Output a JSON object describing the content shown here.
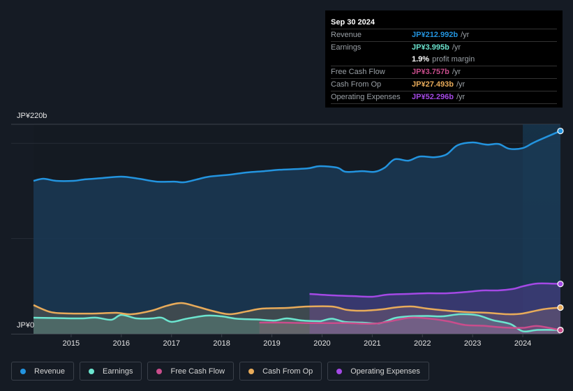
{
  "tooltip": {
    "date": "Sep 30 2024",
    "rows": [
      {
        "label": "Revenue",
        "value": "JP¥212.992b",
        "unit": "/yr",
        "color": "#2394df"
      },
      {
        "label": "Earnings",
        "value": "JP¥3.995b",
        "unit": "/yr",
        "color": "#6ce5cf"
      },
      {
        "label": "",
        "value": "1.9%",
        "unit": "profit margin",
        "color": "#ffffff"
      },
      {
        "label": "Free Cash Flow",
        "value": "JP¥3.757b",
        "unit": "/yr",
        "color": "#c94d8c"
      },
      {
        "label": "Cash From Op",
        "value": "JP¥27.493b",
        "unit": "/yr",
        "color": "#e8ab5a"
      },
      {
        "label": "Operating Expenses",
        "value": "JP¥52.296b",
        "unit": "/yr",
        "color": "#a449e5"
      }
    ]
  },
  "legend": [
    {
      "label": "Revenue",
      "color": "#2394df"
    },
    {
      "label": "Earnings",
      "color": "#6ce5cf"
    },
    {
      "label": "Free Cash Flow",
      "color": "#c94d8c"
    },
    {
      "label": "Cash From Op",
      "color": "#e8ab5a"
    },
    {
      "label": "Operating Expenses",
      "color": "#a449e5"
    }
  ],
  "chart_data": {
    "type": "area",
    "title": "",
    "xlabel": "",
    "ylabel": "",
    "y_top_label": "JP¥220b",
    "y_bottom_label": "JP¥0",
    "ylim": [
      0,
      220
    ],
    "xlim": [
      2014.25,
      2024.75
    ],
    "x_ticks": [
      2015,
      2016,
      2017,
      2018,
      2019,
      2020,
      2021,
      2022,
      2023,
      2024
    ],
    "gridlines": [
      100,
      200,
      220
    ],
    "highlight_from": 2024.0,
    "unit": "JP¥ billions",
    "series": [
      {
        "name": "Revenue",
        "color": "#2394df",
        "points": [
          [
            2014.25,
            160.6
          ],
          [
            2014.45,
            162.8
          ],
          [
            2014.7,
            160.6
          ],
          [
            2015.05,
            160.6
          ],
          [
            2015.25,
            162
          ],
          [
            2015.6,
            163.4
          ],
          [
            2016.0,
            165
          ],
          [
            2016.35,
            162.8
          ],
          [
            2016.7,
            159.8
          ],
          [
            2017.05,
            159.8
          ],
          [
            2017.25,
            159.1
          ],
          [
            2017.5,
            162
          ],
          [
            2017.75,
            165
          ],
          [
            2018.15,
            167
          ],
          [
            2018.5,
            169.4
          ],
          [
            2018.85,
            170.8
          ],
          [
            2019.15,
            172.2
          ],
          [
            2019.7,
            173.6
          ],
          [
            2019.95,
            176
          ],
          [
            2020.3,
            174.5
          ],
          [
            2020.47,
            170.1
          ],
          [
            2020.8,
            170.8
          ],
          [
            2021.05,
            170.1
          ],
          [
            2021.25,
            174.5
          ],
          [
            2021.45,
            183.3
          ],
          [
            2021.72,
            181.8
          ],
          [
            2021.95,
            186.2
          ],
          [
            2022.25,
            185.4
          ],
          [
            2022.48,
            188.4
          ],
          [
            2022.7,
            198
          ],
          [
            2023.0,
            200.9
          ],
          [
            2023.28,
            198.6
          ],
          [
            2023.52,
            199.3
          ],
          [
            2023.73,
            194.3
          ],
          [
            2024.0,
            195
          ],
          [
            2024.25,
            201.6
          ],
          [
            2024.75,
            213.0
          ]
        ]
      },
      {
        "name": "Earnings",
        "color": "#6ce5cf",
        "points": [
          [
            2014.25,
            16.9
          ],
          [
            2014.7,
            16.5
          ],
          [
            2015.2,
            16.1
          ],
          [
            2015.5,
            16.9
          ],
          [
            2015.8,
            14.7
          ],
          [
            2016.0,
            19.8
          ],
          [
            2016.3,
            16.1
          ],
          [
            2016.6,
            16.1
          ],
          [
            2016.8,
            16.9
          ],
          [
            2017.0,
            12.5
          ],
          [
            2017.3,
            15.8
          ],
          [
            2017.7,
            19.1
          ],
          [
            2018.0,
            18.3
          ],
          [
            2018.3,
            15.8
          ],
          [
            2018.7,
            15
          ],
          [
            2019.05,
            13.9
          ],
          [
            2019.3,
            16.1
          ],
          [
            2019.6,
            13.9
          ],
          [
            2019.95,
            13.2
          ],
          [
            2020.0,
            13.6
          ],
          [
            2020.2,
            15.8
          ],
          [
            2020.45,
            12.5
          ],
          [
            2020.8,
            11.7
          ],
          [
            2021.15,
            11
          ],
          [
            2021.45,
            16.5
          ],
          [
            2021.75,
            18.3
          ],
          [
            2022.1,
            18.7
          ],
          [
            2022.4,
            18.3
          ],
          [
            2022.75,
            20.5
          ],
          [
            2023.1,
            19.4
          ],
          [
            2023.4,
            14.3
          ],
          [
            2023.75,
            10.3
          ],
          [
            2024.0,
            2.6
          ],
          [
            2024.3,
            4.0
          ],
          [
            2024.75,
            4.0
          ]
        ]
      },
      {
        "name": "Free Cash Flow",
        "color": "#c94d8c",
        "points": [
          [
            2018.75,
            11.7
          ],
          [
            2019.2,
            11.7
          ],
          [
            2019.7,
            11.2
          ],
          [
            2020.1,
            11.2
          ],
          [
            2020.5,
            11.2
          ],
          [
            2021.0,
            10.5
          ],
          [
            2021.3,
            12.5
          ],
          [
            2021.75,
            16.9
          ],
          [
            2022.1,
            16.1
          ],
          [
            2022.5,
            13.2
          ],
          [
            2022.85,
            9.2
          ],
          [
            2023.2,
            8.4
          ],
          [
            2023.6,
            6.6
          ],
          [
            2024.0,
            6.2
          ],
          [
            2024.3,
            8.1
          ],
          [
            2024.75,
            3.8
          ]
        ]
      },
      {
        "name": "Cash From Op",
        "color": "#e8ab5a",
        "points": [
          [
            2014.25,
            30.1
          ],
          [
            2014.6,
            22.7
          ],
          [
            2015.0,
            21.3
          ],
          [
            2015.5,
            21.3
          ],
          [
            2015.9,
            22
          ],
          [
            2016.2,
            20.5
          ],
          [
            2016.6,
            24.2
          ],
          [
            2016.9,
            29.3
          ],
          [
            2017.2,
            32.3
          ],
          [
            2017.5,
            28.6
          ],
          [
            2017.8,
            24.2
          ],
          [
            2018.15,
            20.5
          ],
          [
            2018.5,
            23.5
          ],
          [
            2018.8,
            26.4
          ],
          [
            2019.3,
            27.1
          ],
          [
            2019.7,
            28.6
          ],
          [
            2020.2,
            28.6
          ],
          [
            2020.5,
            25
          ],
          [
            2020.8,
            24.2
          ],
          [
            2021.2,
            25.7
          ],
          [
            2021.5,
            27.9
          ],
          [
            2021.8,
            28.6
          ],
          [
            2022.1,
            26.4
          ],
          [
            2022.5,
            24.2
          ],
          [
            2022.9,
            22.7
          ],
          [
            2023.3,
            22
          ],
          [
            2023.7,
            20.5
          ],
          [
            2024.0,
            21.3
          ],
          [
            2024.4,
            25.7
          ],
          [
            2024.75,
            27.5
          ]
        ]
      },
      {
        "name": "Operating Expenses",
        "color": "#a449e5",
        "points": [
          [
            2019.75,
            41.8
          ],
          [
            2020.2,
            40.3
          ],
          [
            2020.6,
            39.6
          ],
          [
            2021.0,
            38.9
          ],
          [
            2021.3,
            41.1
          ],
          [
            2021.7,
            41.8
          ],
          [
            2022.1,
            42.5
          ],
          [
            2022.5,
            42.5
          ],
          [
            2022.9,
            44
          ],
          [
            2023.2,
            45.5
          ],
          [
            2023.5,
            45.5
          ],
          [
            2023.8,
            47
          ],
          [
            2024.0,
            49.8
          ],
          [
            2024.3,
            52.8
          ],
          [
            2024.75,
            52.3
          ]
        ]
      }
    ]
  }
}
